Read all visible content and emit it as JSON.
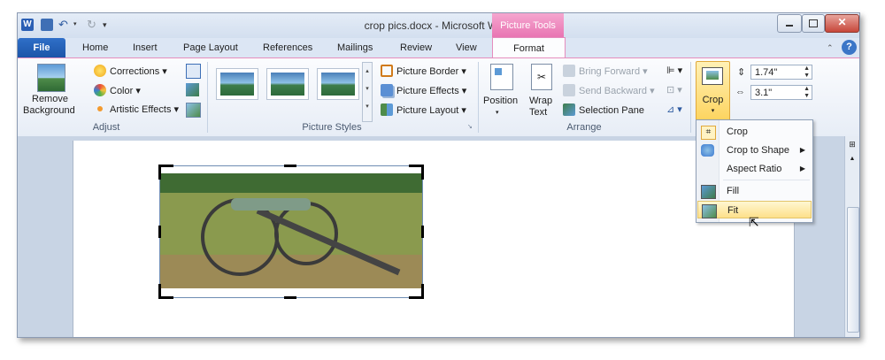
{
  "window": {
    "title": "crop pics.docx - Microsoft Word",
    "context_tab": "Picture Tools"
  },
  "tabs": {
    "file": "File",
    "home": "Home",
    "insert": "Insert",
    "page_layout": "Page Layout",
    "references": "References",
    "mailings": "Mailings",
    "review": "Review",
    "view": "View",
    "format": "Format"
  },
  "adjust": {
    "remove_background": [
      "Remove",
      "Background"
    ],
    "corrections": "Corrections",
    "color": "Color",
    "artistic_effects": "Artistic Effects",
    "label": "Adjust"
  },
  "picture_styles": {
    "border": "Picture Border",
    "effects": "Picture Effects",
    "layout": "Picture Layout",
    "label": "Picture Styles"
  },
  "arrange": {
    "position": "Position",
    "wrap_text": [
      "Wrap",
      "Text"
    ],
    "bring_forward": "Bring Forward",
    "send_backward": "Send Backward",
    "selection_pane": "Selection Pane",
    "label": "Arrange"
  },
  "size": {
    "crop": "Crop",
    "height": "1.74\"",
    "width": "3.1\""
  },
  "crop_menu": {
    "items": [
      "Crop",
      "Crop to Shape",
      "Aspect Ratio",
      "Fill",
      "Fit"
    ],
    "highlighted": "Fit"
  },
  "colors": {
    "accent_pink": "#e873b1",
    "file_blue": "#1c55a8",
    "highlight": "#fde08a"
  }
}
